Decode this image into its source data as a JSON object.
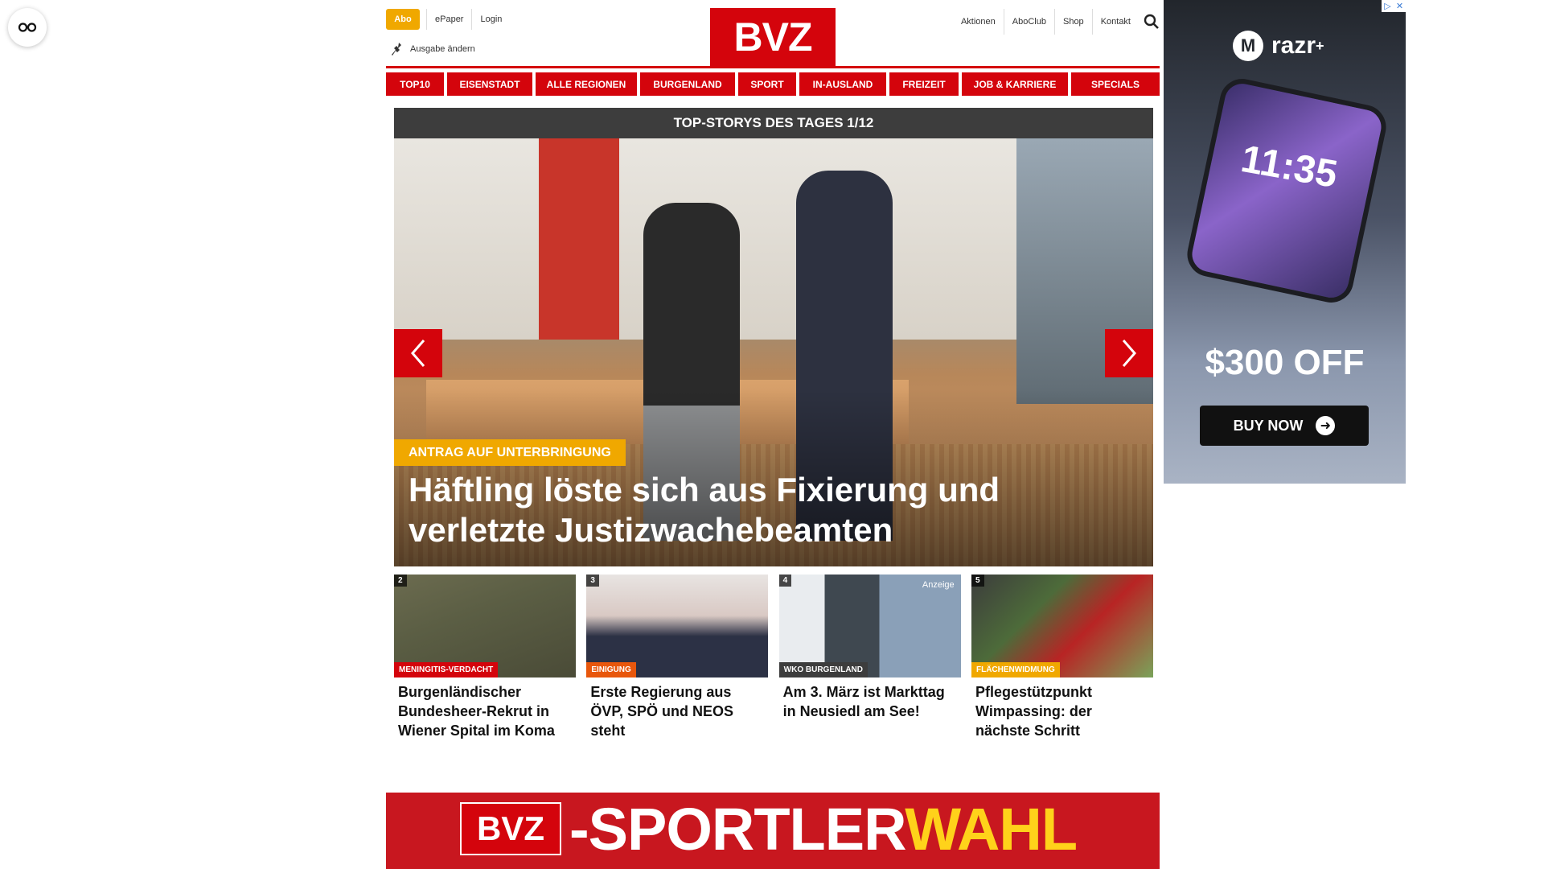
{
  "header": {
    "abo_label": "Abo",
    "epaper_label": "ePaper",
    "login_label": "Login",
    "edition_label": "Ausgabe ändern",
    "logo_text": "BVZ",
    "right_links": [
      "Aktionen",
      "AboClub",
      "Shop",
      "Kontakt"
    ]
  },
  "nav": {
    "items": [
      "TOP10",
      "EISENSTADT",
      "ALLE REGIONEN",
      "BURGENLAND",
      "SPORT",
      "IN-AUSLAND",
      "FREIZEIT",
      "JOB & KARRIERE",
      "SPECIALS"
    ]
  },
  "top_stories": {
    "heading": "TOP-STORYS DES TAGES 1/12",
    "hero": {
      "tag": "ANTRAG AUF UNTERBRINGUNG",
      "title": "Häftling löste sich aus Fixierung und verletzte Justizwachebeamten"
    },
    "teasers": [
      {
        "num": "2",
        "tag": "MENINGITIS-VERDACHT",
        "tag_color": "#d4040c",
        "title": "Burgenländischer Bundesheer-Rekrut in Wiener Spital im Koma"
      },
      {
        "num": "3",
        "tag": "EINIGUNG",
        "tag_color": "#e8570c",
        "title": "Erste Regierung aus ÖVP, SPÖ und NEOS steht"
      },
      {
        "num": "4",
        "tag": "WKO BURGENLAND",
        "tag_color": "#3d3d3d",
        "title": "Am 3. März ist Markttag in Neusiedl am See!",
        "ad_label": "Anzeige"
      },
      {
        "num": "5",
        "tag": "FLÄCHENWIDMUNG",
        "tag_color": "#f0a800",
        "title": "Pflegestützpunkt Wimpassing: der nächste Schritt"
      }
    ]
  },
  "banner": {
    "logo": "BVZ",
    "text_white": "-SPORTLER",
    "text_yellow": "WAHL"
  },
  "ad": {
    "brand": "razr",
    "brand_sup": "+",
    "clock": "11:35",
    "offer": "$300 OFF",
    "cta": "BUY NOW"
  },
  "colors": {
    "brand_red": "#d4040c",
    "accent_yellow": "#f0a800"
  }
}
